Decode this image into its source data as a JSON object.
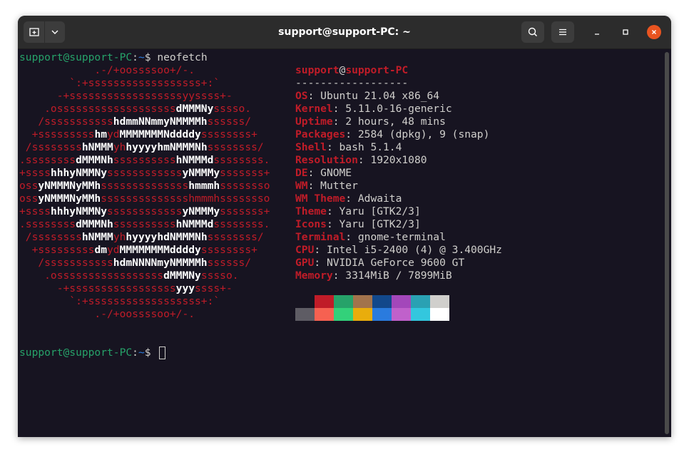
{
  "window": {
    "title": "support@support-PC: ~",
    "icons": [
      "new-tab-icon",
      "chevron-down-icon",
      "search-icon",
      "hamburger-menu-icon",
      "minimize-icon",
      "maximize-icon",
      "close-icon"
    ],
    "close_color": "#e95420"
  },
  "terminal": {
    "prompt_user_host": "support@support-PC",
    "prompt_sep": ":",
    "prompt_path": "~",
    "prompt_symbol": "$",
    "command": " neofetch",
    "logo": [
      [
        [
          "r",
          "            .-/+oossssoo+/-."
        ]
      ],
      [
        [
          "r",
          "        `:+ssssssssssssssssss+:`"
        ]
      ],
      [
        [
          "r",
          "      -+ssssssssssssssssssyyssss+-"
        ]
      ],
      [
        [
          "r",
          "    .osssssssssssssssssss"
        ],
        [
          "wb",
          "dMMMNy"
        ],
        [
          "r",
          "sssso."
        ]
      ],
      [
        [
          "r",
          "   /sssssssssss"
        ],
        [
          "wb",
          "hdmmNNmmyNMMMMh"
        ],
        [
          "r",
          "ssssss/"
        ]
      ],
      [
        [
          "r",
          "  +sssssssss"
        ],
        [
          "wb",
          "hm"
        ],
        [
          "r",
          "yd"
        ],
        [
          "wb",
          "MMMMMMMNddddy"
        ],
        [
          "r",
          "ssssssss+"
        ]
      ],
      [
        [
          "r",
          " /ssssssss"
        ],
        [
          "wb",
          "hNMMM"
        ],
        [
          "r",
          "yh"
        ],
        [
          "wb",
          "hyyyyhmNMMMNh"
        ],
        [
          "r",
          "ssssssss/"
        ]
      ],
      [
        [
          "r",
          ".ssssssss"
        ],
        [
          "wb",
          "dMMMNh"
        ],
        [
          "r",
          "ssssssssss"
        ],
        [
          "wb",
          "hNMMMd"
        ],
        [
          "r",
          "ssssssss."
        ]
      ],
      [
        [
          "r",
          "+ssss"
        ],
        [
          "wb",
          "hhhyNMMNy"
        ],
        [
          "r",
          "ssssssssssss"
        ],
        [
          "wb",
          "yNMMMy"
        ],
        [
          "r",
          "sssssss+"
        ]
      ],
      [
        [
          "r",
          "oss"
        ],
        [
          "wb",
          "yNMMMNyMMh"
        ],
        [
          "r",
          "ssssssssssssss"
        ],
        [
          "wb",
          "hmmmh"
        ],
        [
          "r",
          "ssssssso"
        ]
      ],
      [
        [
          "r",
          "oss"
        ],
        [
          "wb",
          "yNMMMNyMMh"
        ],
        [
          "r",
          "sssssssssssssshmmmhssssssso"
        ]
      ],
      [
        [
          "r",
          "+ssss"
        ],
        [
          "wb",
          "hhhyNMMNy"
        ],
        [
          "r",
          "ssssssssssss"
        ],
        [
          "wb",
          "yNMMMy"
        ],
        [
          "r",
          "sssssss+"
        ]
      ],
      [
        [
          "r",
          ".ssssssss"
        ],
        [
          "wb",
          "dMMMNh"
        ],
        [
          "r",
          "ssssssssss"
        ],
        [
          "wb",
          "hNMMMd"
        ],
        [
          "r",
          "ssssssss."
        ]
      ],
      [
        [
          "r",
          " /ssssssss"
        ],
        [
          "wb",
          "hNMMM"
        ],
        [
          "r",
          "yh"
        ],
        [
          "wb",
          "hyyyyhdNMMMNh"
        ],
        [
          "r",
          "ssssssss/"
        ]
      ],
      [
        [
          "r",
          "  +sssssssss"
        ],
        [
          "wb",
          "dm"
        ],
        [
          "r",
          "yd"
        ],
        [
          "wb",
          "MMMMMMMMddddy"
        ],
        [
          "r",
          "ssssssss+"
        ]
      ],
      [
        [
          "r",
          "   /sssssssssss"
        ],
        [
          "wb",
          "hdmNNNNmyNMMMMh"
        ],
        [
          "r",
          "ssssss/"
        ]
      ],
      [
        [
          "r",
          "    .osssssssssssssssss"
        ],
        [
          "wb",
          "dMMMNy"
        ],
        [
          "r",
          "sssso."
        ]
      ],
      [
        [
          "r",
          "      -+sssssssssssssssss"
        ],
        [
          "wb",
          "yyy"
        ],
        [
          "r",
          "ssss+-"
        ]
      ],
      [
        [
          "r",
          "        `:+ssssssssssssssssss+:`"
        ]
      ],
      [
        [
          "r",
          "            .-/+oossssoo+/-."
        ]
      ]
    ],
    "info_user": "support",
    "info_at": "@",
    "info_host": "support-PC",
    "info_separator": "------------------",
    "info": [
      {
        "key": "OS",
        "value": "Ubuntu 21.04 x86_64"
      },
      {
        "key": "Kernel",
        "value": "5.11.0-16-generic"
      },
      {
        "key": "Uptime",
        "value": "2 hours, 48 mins"
      },
      {
        "key": "Packages",
        "value": "2584 (dpkg), 9 (snap)"
      },
      {
        "key": "Shell",
        "value": "bash 5.1.4"
      },
      {
        "key": "Resolution",
        "value": "1920x1080"
      },
      {
        "key": "DE",
        "value": "GNOME"
      },
      {
        "key": "WM",
        "value": "Mutter"
      },
      {
        "key": "WM Theme",
        "value": "Adwaita"
      },
      {
        "key": "Theme",
        "value": "Yaru [GTK2/3]"
      },
      {
        "key": "Icons",
        "value": "Yaru [GTK2/3]"
      },
      {
        "key": "Terminal",
        "value": "gnome-terminal"
      },
      {
        "key": "CPU",
        "value": "Intel i5-2400 (4) @ 3.400GHz"
      },
      {
        "key": "GPU",
        "value": "NVIDIA GeForce 9600 GT"
      },
      {
        "key": "Memory",
        "value": "3314MiB / 7899MiB"
      }
    ],
    "palette_row1": [
      "#171421",
      "#c01c28",
      "#26a269",
      "#a2734c",
      "#12488b",
      "#a347ba",
      "#2aa1b3",
      "#d0cfcc"
    ],
    "palette_row2": [
      "#5e5c64",
      "#f66151",
      "#33d17a",
      "#e9ad0c",
      "#2a7bde",
      "#c061cb",
      "#33c7de",
      "#ffffff"
    ]
  }
}
